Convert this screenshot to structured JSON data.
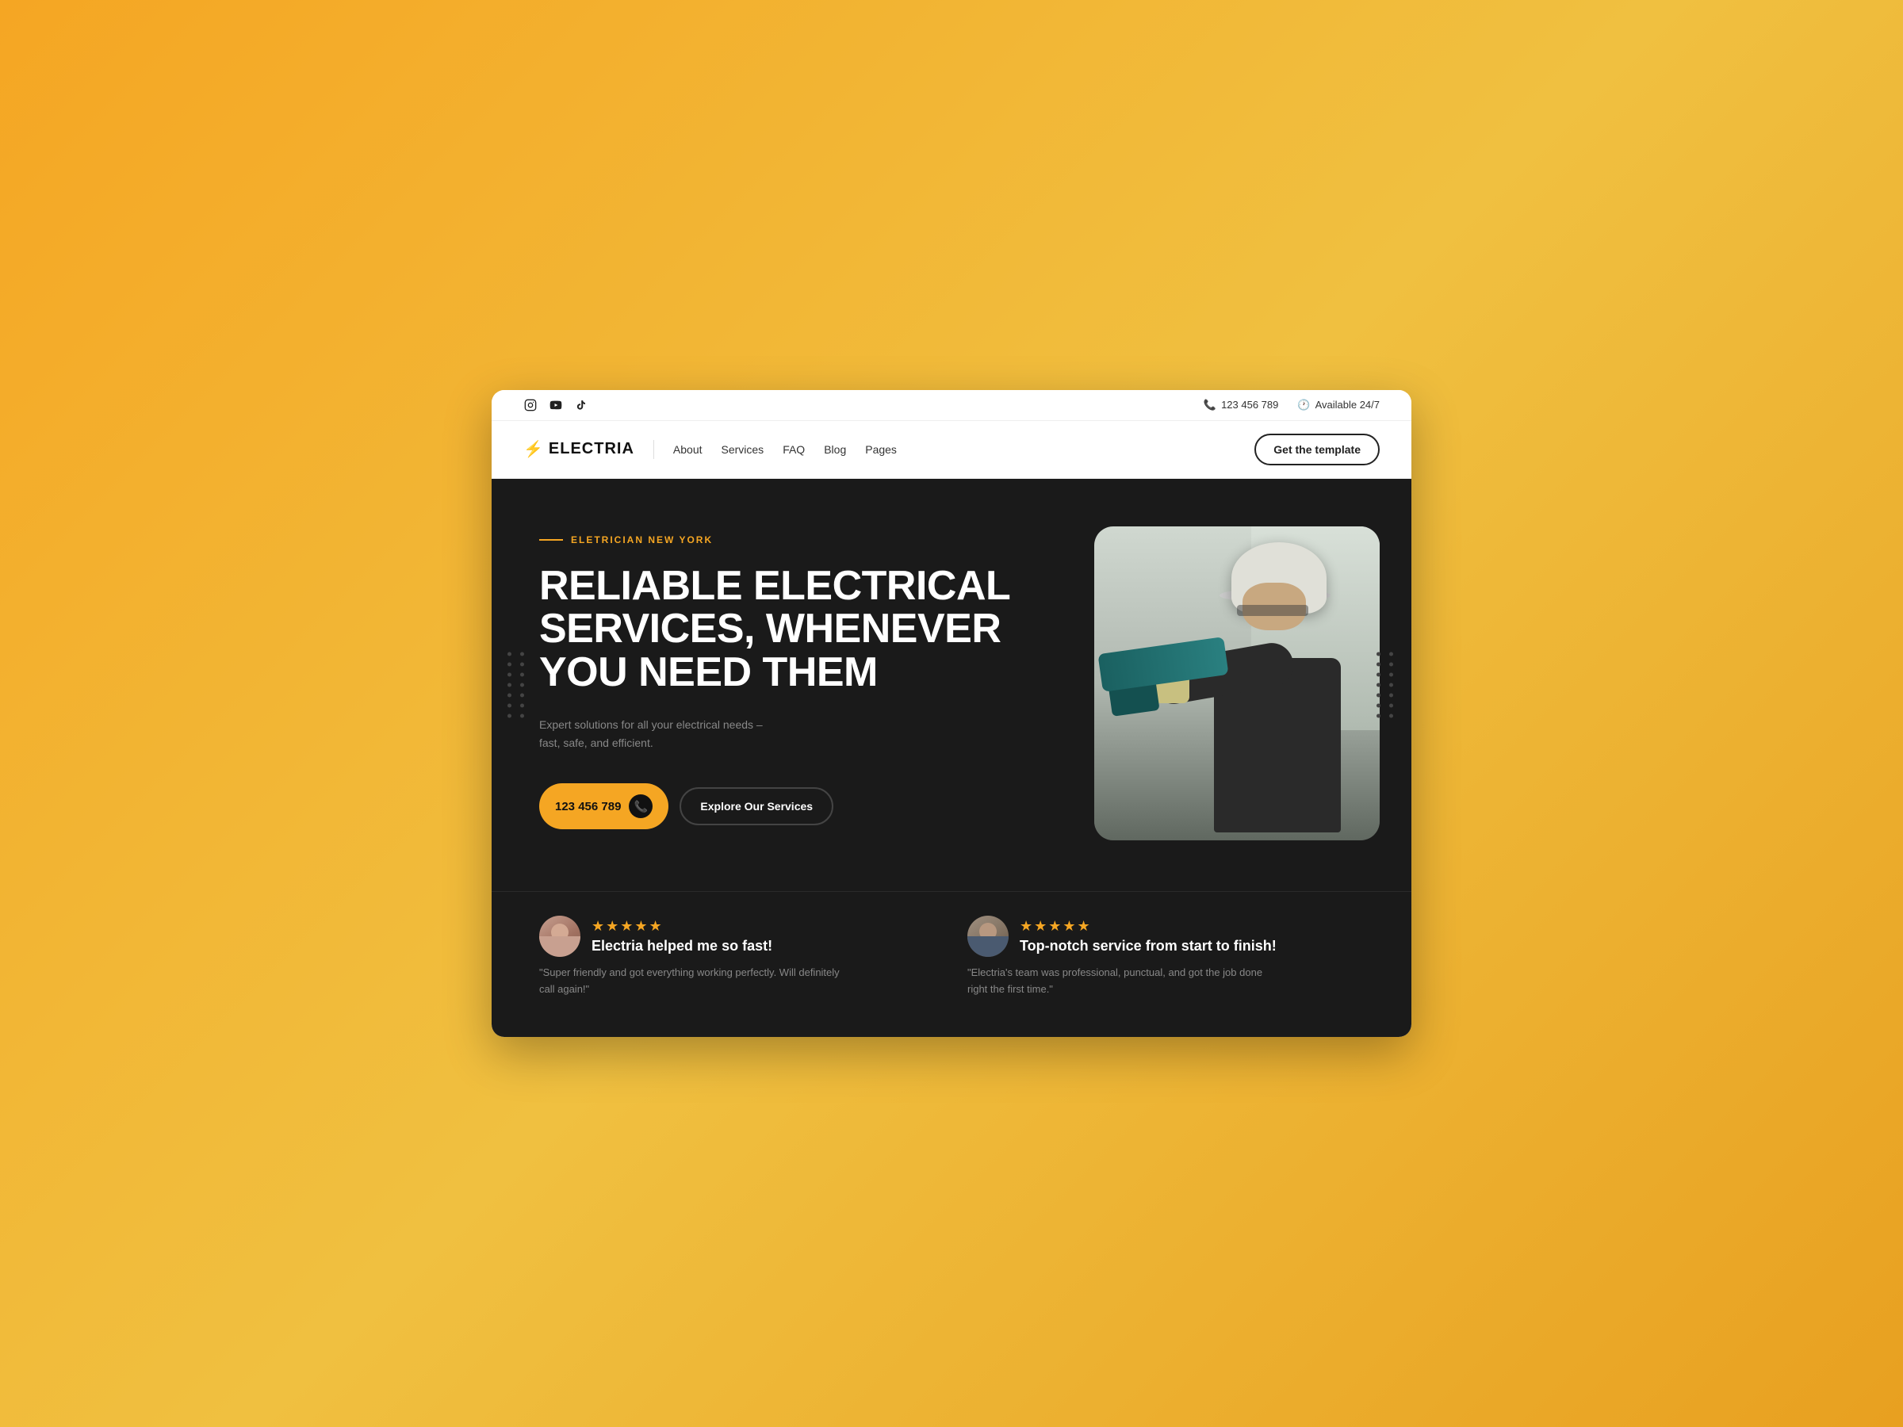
{
  "topbar": {
    "phone": "123 456 789",
    "availability": "Available 24/7",
    "social": [
      "instagram-icon",
      "youtube-icon",
      "tiktok-icon"
    ]
  },
  "navbar": {
    "logo_text": "ELECTRIA",
    "nav_items": [
      {
        "label": "About"
      },
      {
        "label": "Services"
      },
      {
        "label": "FAQ"
      },
      {
        "label": "Blog"
      },
      {
        "label": "Pages"
      }
    ],
    "cta_label": "Get the template"
  },
  "hero": {
    "tag": "ELETRICIAN NEW YORK",
    "title_line1": "RELIABLE ELECTRICAL",
    "title_line2": "SERVICES, WHENEVER",
    "title_line3": "YOU NEED THEM",
    "subtitle": "Expert solutions for all your electrical needs – fast, safe, and efficient.",
    "phone_label": "123 456 789",
    "services_btn": "Explore Our Services"
  },
  "dot_count": 14,
  "reviews": [
    {
      "stars": "★★★★★",
      "title": "Electria helped me so fast!",
      "text": "\"Super friendly and got everything working perfectly. Will definitely call again!\"",
      "avatar_type": "female"
    },
    {
      "stars": "★★★★★",
      "title": "Top-notch service from start to finish!",
      "text": "\"Electria's team was professional, punctual, and got the job done right the first time.\"",
      "avatar_type": "male"
    }
  ],
  "colors": {
    "accent": "#f5a623",
    "dark_bg": "#1a1a1a",
    "text_muted": "#888888"
  }
}
